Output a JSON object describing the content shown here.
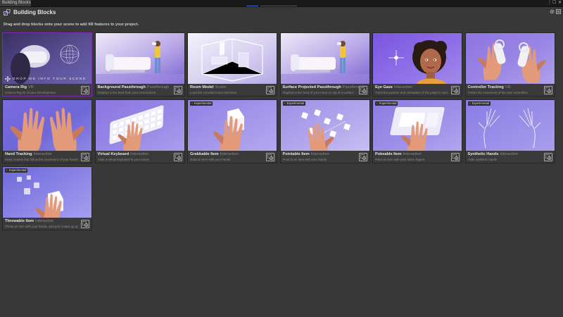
{
  "window": {
    "tab_title": "Building Blocks",
    "controls": {
      "more": "⋮",
      "maximize": "☐",
      "close": "✕"
    }
  },
  "header": {
    "title": "Building Blocks",
    "subtitle": "Drag and drop blocks onto your scene to add XR features to your project.",
    "icons": [
      "gear-icon",
      "menu-icon"
    ]
  },
  "badge_label": "Experimental",
  "drop_hint": "DROP ME INTO YOUR SCENE",
  "accent_color": "#7b2bb0",
  "blocks": [
    {
      "name": "Camera Rig",
      "category": "VR",
      "description": "Camera Rig for Oculus Development",
      "experimental": false,
      "selected": true,
      "art": "camera-rig"
    },
    {
      "name": "Background Passthrough",
      "category": "Passthrough",
      "description": "Displays a live feed from your environment",
      "experimental": false,
      "selected": false,
      "art": "living-room"
    },
    {
      "name": "Room Model",
      "category": "Scene",
      "description": "Load the recorded room elements",
      "experimental": false,
      "selected": false,
      "art": "room-model"
    },
    {
      "name": "Surface Projected Passthrough",
      "category": "Passthrough",
      "description": "Displays a live feed of your room on top of a surface",
      "experimental": false,
      "selected": false,
      "art": "living-room"
    },
    {
      "name": "Eye Gaze",
      "category": "Interaction",
      "description": "Track the position and orientation of the player's eyes",
      "experimental": false,
      "selected": false,
      "art": "eye-gaze"
    },
    {
      "name": "Controller Tracking",
      "category": "VR",
      "description": "Tracks the movement of the user controllers",
      "experimental": false,
      "selected": false,
      "art": "controllers"
    },
    {
      "name": "Hand Tracking",
      "category": "Interaction",
      "description": "Hand models that follow the movement of your hands",
      "experimental": false,
      "selected": false,
      "art": "hands"
    },
    {
      "name": "Virtual Keyboard",
      "category": "Interaction",
      "description": "Adds a virtual keyboard to your scene",
      "experimental": false,
      "selected": false,
      "art": "keyboard"
    },
    {
      "name": "Grabbable Item",
      "category": "Interaction",
      "description": "Grab an item with your hands",
      "experimental": true,
      "selected": false,
      "art": "grab"
    },
    {
      "name": "Pointable Item",
      "category": "Interaction",
      "description": "Point to an item with your hands",
      "experimental": true,
      "selected": false,
      "art": "point"
    },
    {
      "name": "Pokeable Item",
      "category": "Interaction",
      "description": "Poke an item with your index fingers",
      "experimental": true,
      "selected": false,
      "art": "poke"
    },
    {
      "name": "Synthetic Hands",
      "category": "Interaction",
      "description": "Adds synthetic hands",
      "experimental": true,
      "selected": false,
      "art": "synthetic"
    },
    {
      "name": "Throwable Item",
      "category": "Interaction",
      "description": "Throw an item with your hands, and pick it back up again",
      "experimental": true,
      "selected": false,
      "art": "throw"
    }
  ]
}
